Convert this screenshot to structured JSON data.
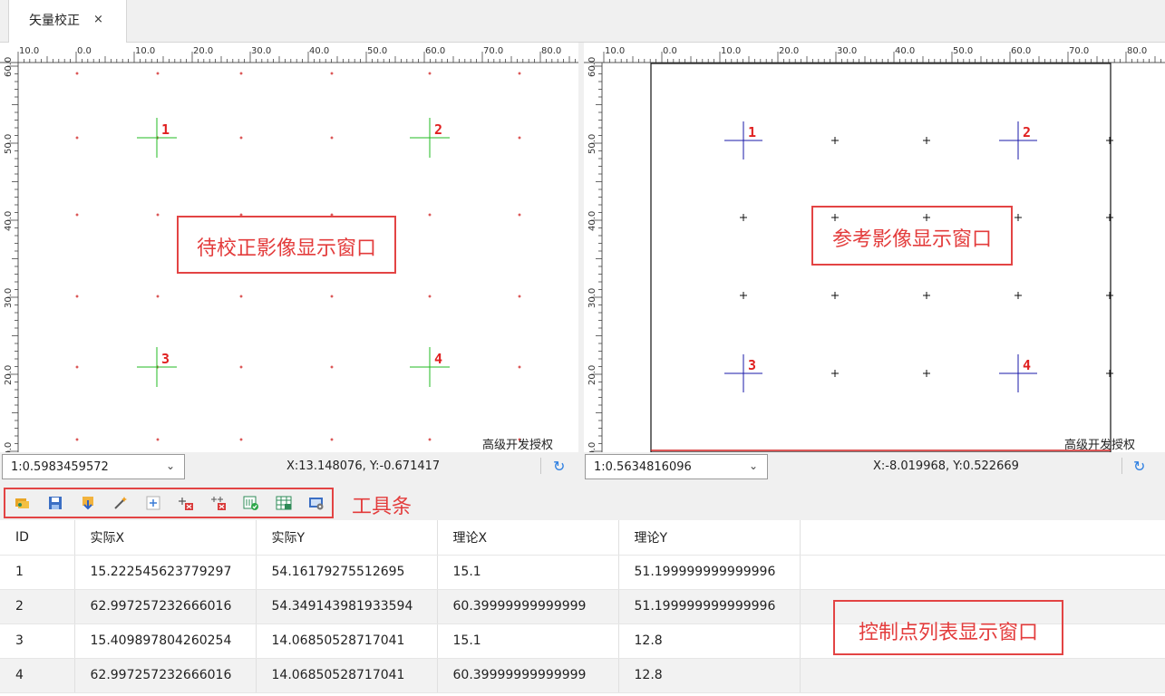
{
  "tab": {
    "label": "矢量校正",
    "close_label": "×"
  },
  "left_panel": {
    "ruler_x_labels": [
      "10.0",
      "0.0",
      "10.0",
      "20.0",
      "30.0",
      "40.0",
      "50.0",
      "60.0",
      "70.0",
      "80.0"
    ],
    "ruler_y_labels": [
      "60.0",
      "50.0",
      "40.0",
      "30.0",
      "20.0",
      "10.0",
      "0.0"
    ],
    "point_labels": [
      "1",
      "2",
      "3",
      "4"
    ],
    "watermark": "高级开发授权",
    "scale": "1:0.5983459572",
    "coords": "X:13.148076, Y:-0.671417",
    "annotation": "待校正影像显示窗口",
    "point_color": "#22bb22",
    "label_color": "#e02020"
  },
  "right_panel": {
    "ruler_x_labels": [
      "10.0",
      "0.0",
      "10.0",
      "20.0",
      "30.0",
      "40.0",
      "50.0",
      "60.0",
      "70.0",
      "80.0"
    ],
    "ruler_y_labels": [
      "60.0",
      "50.0",
      "40.0",
      "30.0",
      "20.0",
      "10.0",
      "0.0"
    ],
    "point_labels": [
      "1",
      "2",
      "3",
      "4"
    ],
    "watermark": "高级开发授权",
    "scale": "1:0.5634816096",
    "coords": "X:-8.019968, Y:0.522669",
    "annotation": "参考影像显示窗口",
    "point_color": "#1a1aa8",
    "label_color": "#e02020"
  },
  "toolbar": {
    "annotation": "工具条",
    "buttons": [
      "open-points-icon",
      "save-icon",
      "export-icon",
      "magic-wand-icon",
      "add-point-icon",
      "delete-point-icon",
      "delete-all-icon",
      "check-icon",
      "grid-icon",
      "settings-icon"
    ]
  },
  "table": {
    "headers": [
      "ID",
      "实际X",
      "实际Y",
      "理论X",
      "理论Y",
      ""
    ],
    "rows": [
      [
        "1",
        "15.222545623779297",
        "54.16179275512695",
        "15.1",
        "51.199999999999996",
        ""
      ],
      [
        "2",
        "62.997257232666016",
        "54.349143981933594",
        "60.39999999999999",
        "51.199999999999996",
        ""
      ],
      [
        "3",
        "15.409897804260254",
        "14.06850528717041",
        "15.1",
        "12.8",
        ""
      ],
      [
        "4",
        "62.997257232666016",
        "14.06850528717041",
        "60.39999999999999",
        "12.8",
        ""
      ]
    ],
    "annotation": "控制点列表显示窗口"
  }
}
